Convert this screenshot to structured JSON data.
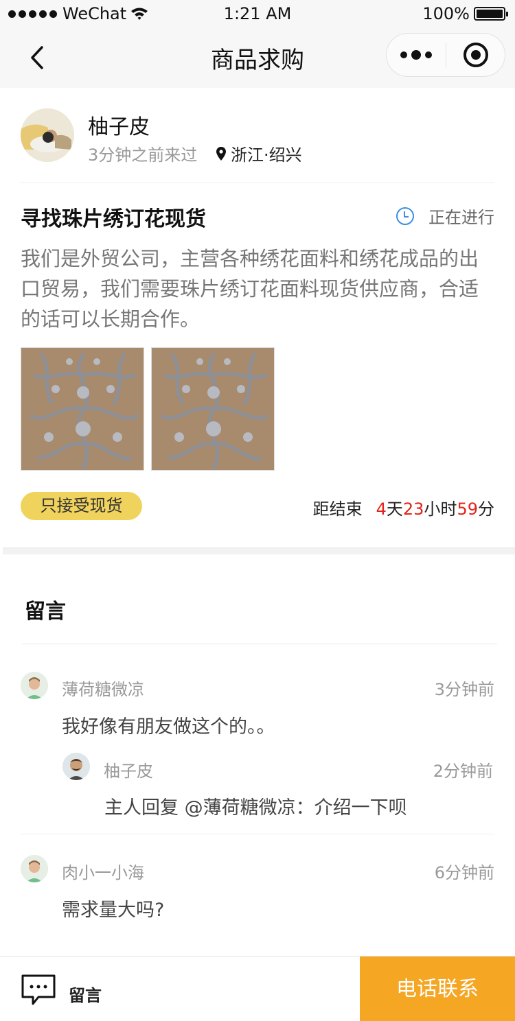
{
  "status_bar": {
    "carrier": "WeChat",
    "time": "1:21 AM",
    "battery": "100%"
  },
  "nav": {
    "title": "商品求购"
  },
  "user": {
    "name": "柚子皮",
    "visited": "3分钟之前来过",
    "location": "浙江·绍兴"
  },
  "post": {
    "title": "寻找珠片绣订花现货",
    "status": "正在进行",
    "body": "我们是外贸公司，主营各种绣花面料和绣花成品的出口贸易，我们需要珠片绣订花面料现货供应商，合适的话可以长期合作。",
    "tag": "只接受现货",
    "countdown": {
      "label": "距结束",
      "days": "4",
      "days_unit": "天",
      "hours": "23",
      "hours_unit": "小时",
      "minutes": "59",
      "minutes_unit": "分"
    }
  },
  "comments_section": {
    "title": "留言",
    "comments": [
      {
        "name": "薄荷糖微凉",
        "time": "3分钟前",
        "text": "我好像有朋友做这个的。。",
        "reply": {
          "name": "柚子皮",
          "time": "2分钟前",
          "text": "主人回复 @薄荷糖微凉：介绍一下呗"
        }
      },
      {
        "name": "肉小一小海",
        "time": "6分钟前",
        "text": "需求量大吗?"
      }
    ]
  },
  "bottom_bar": {
    "message_label": "留言",
    "call_label": "电话联系"
  },
  "colors": {
    "accent_orange": "#f5a623",
    "tag_yellow": "#f0d35c",
    "countdown_red": "#e4231a",
    "status_blue": "#3b8fe0"
  }
}
